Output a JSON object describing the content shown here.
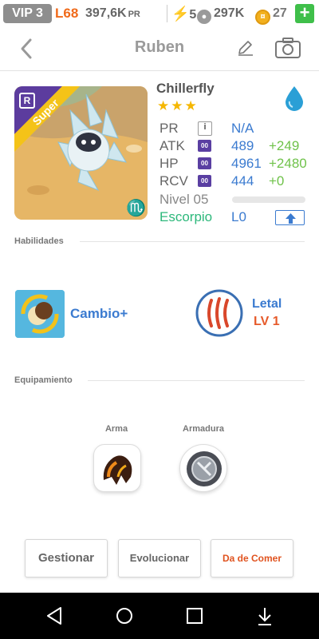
{
  "status": {
    "vip": "VIP 3",
    "level": "L68",
    "pr_value": "397,6K",
    "pr_unit": "PR",
    "energy": "5",
    "paws": "297K",
    "coins": "27",
    "add_label": "+"
  },
  "header": {
    "title": "Ruben"
  },
  "pet": {
    "rarity_badge": "R",
    "ribbon": "Super",
    "name": "Chillerfly",
    "stars": "★★★",
    "zodiac_symbol": "♏",
    "stats": [
      {
        "label": "PR",
        "icon": "i",
        "value": "N/A",
        "bonus": ""
      },
      {
        "label": "ATK",
        "icon": "00",
        "value": "489",
        "bonus": "+249"
      },
      {
        "label": "HP",
        "icon": "00",
        "value": "4961",
        "bonus": "+2480"
      },
      {
        "label": "RCV",
        "icon": "00",
        "value": "444",
        "bonus": "+0"
      }
    ],
    "level_label": "Nivel 05",
    "sign": "Escorpio",
    "sign_level": "L0"
  },
  "skills_section": "Habilidades",
  "skills": [
    {
      "name": "Cambio+"
    },
    {
      "name": "Letal",
      "level": "LV 1"
    }
  ],
  "equipment_section": "Equipamiento",
  "equipment": [
    {
      "label": "Arma"
    },
    {
      "label": "Armadura"
    }
  ],
  "buttons": {
    "manage": "Gestionar",
    "evolve": "Evolucionar",
    "feed": "Da de Comer"
  },
  "colors": {
    "accent_blue": "#3b7bd0",
    "bonus_green": "#6fc24a",
    "zodiac_green": "#2db87b",
    "level_orange": "#f06a1a",
    "feed_red": "#e0531f"
  }
}
